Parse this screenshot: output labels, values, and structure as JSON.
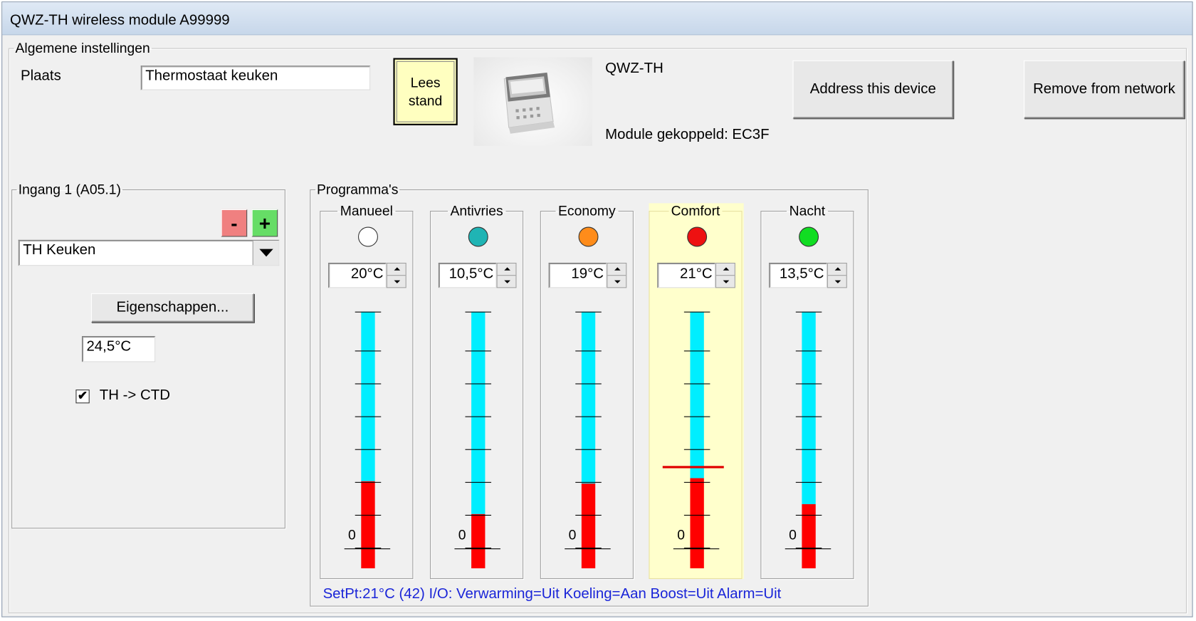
{
  "window": {
    "title": "QWZ-TH wireless module A99999"
  },
  "general": {
    "legend": "Algemene instellingen",
    "plaats_label": "Plaats",
    "plaats_value": "Thermostaat keuken",
    "lees_stand_line1": "Lees",
    "lees_stand_line2": "stand",
    "device_name": "QWZ-TH",
    "module_linked": "Module gekoppeld: EC3F",
    "address_button": "Address this device",
    "remove_button": "Remove from network"
  },
  "input1": {
    "legend": "Ingang 1 (A05.1)",
    "minus_label": "-",
    "plus_label": "+",
    "minus_color": "#f08080",
    "plus_color": "#66dd66",
    "combo_value": "TH Keuken",
    "properties_button": "Eigenschappen...",
    "temperature": "24,5°C",
    "checkbox_label": "TH -> CTD",
    "checkbox_checked": true,
    "checkbox_mark": "✔"
  },
  "programs": {
    "legend": "Programma's",
    "zero_label": "0",
    "active_background": "#ffffcc",
    "fill_color": "#ff0000",
    "empty_color": "#00eeff",
    "items": [
      {
        "name": "Manueel",
        "value_text": "20°C",
        "led_color": "#ffffff",
        "level": 0.34,
        "active": false
      },
      {
        "name": "Antivries",
        "value_text": "10,5°C",
        "led_color": "#1fb4b4",
        "level": 0.21,
        "active": false
      },
      {
        "name": "Economy",
        "value_text": "19°C",
        "led_color": "#ff8c1a",
        "level": 0.33,
        "active": false
      },
      {
        "name": "Comfort",
        "value_text": "21°C",
        "led_color": "#ee1111",
        "level": 0.35,
        "active": true,
        "setpoint_level": 0.4
      },
      {
        "name": "Nacht",
        "value_text": "13,5°C",
        "led_color": "#11dd22",
        "level": 0.25,
        "active": false
      }
    ],
    "status_line": "SetPt:21°C (42)  I/O: Verwarming=Uit  Koeling=Aan  Boost=Uit  Alarm=Uit"
  }
}
